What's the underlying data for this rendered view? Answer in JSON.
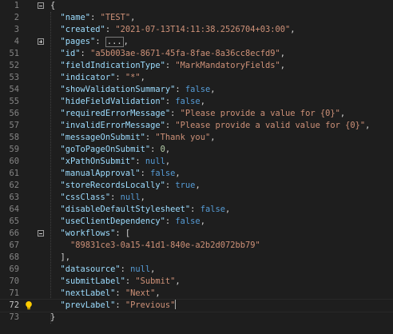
{
  "editor": {
    "lines": [
      {
        "ln": "1",
        "fold": "minus",
        "tokens": [
          {
            "t": "{",
            "c": "p"
          }
        ]
      },
      {
        "ln": "2",
        "tokens": [
          {
            "t": "  ",
            "c": "p"
          },
          {
            "t": "\"name\"",
            "c": "k"
          },
          {
            "t": ": ",
            "c": "p"
          },
          {
            "t": "\"TEST\"",
            "c": "s"
          },
          {
            "t": ",",
            "c": "p"
          }
        ]
      },
      {
        "ln": "3",
        "tokens": [
          {
            "t": "  ",
            "c": "p"
          },
          {
            "t": "\"created\"",
            "c": "k"
          },
          {
            "t": ": ",
            "c": "p"
          },
          {
            "t": "\"2021-07-13T14:11:38.2526704+03:00\"",
            "c": "s"
          },
          {
            "t": ",",
            "c": "p"
          }
        ]
      },
      {
        "ln": "4",
        "fold": "plus",
        "tokens": [
          {
            "t": "  ",
            "c": "p"
          },
          {
            "t": "\"pages\"",
            "c": "k"
          },
          {
            "t": ": ",
            "c": "p"
          },
          {
            "t": "...",
            "c": "collapsed"
          },
          {
            "t": ",",
            "c": "p"
          }
        ]
      },
      {
        "ln": "51",
        "tokens": [
          {
            "t": "  ",
            "c": "p"
          },
          {
            "t": "\"id\"",
            "c": "k"
          },
          {
            "t": ": ",
            "c": "p"
          },
          {
            "t": "\"a5b003ae-8671-45fa-8fae-8a36cc8ecfd9\"",
            "c": "s"
          },
          {
            "t": ",",
            "c": "p"
          }
        ]
      },
      {
        "ln": "52",
        "tokens": [
          {
            "t": "  ",
            "c": "p"
          },
          {
            "t": "\"fieldIndicationType\"",
            "c": "k"
          },
          {
            "t": ": ",
            "c": "p"
          },
          {
            "t": "\"MarkMandatoryFields\"",
            "c": "s"
          },
          {
            "t": ",",
            "c": "p"
          }
        ]
      },
      {
        "ln": "53",
        "tokens": [
          {
            "t": "  ",
            "c": "p"
          },
          {
            "t": "\"indicator\"",
            "c": "k"
          },
          {
            "t": ": ",
            "c": "p"
          },
          {
            "t": "\"*\"",
            "c": "s"
          },
          {
            "t": ",",
            "c": "p"
          }
        ]
      },
      {
        "ln": "54",
        "tokens": [
          {
            "t": "  ",
            "c": "p"
          },
          {
            "t": "\"showValidationSummary\"",
            "c": "k"
          },
          {
            "t": ": ",
            "c": "p"
          },
          {
            "t": "false",
            "c": "kw"
          },
          {
            "t": ",",
            "c": "p"
          }
        ]
      },
      {
        "ln": "55",
        "tokens": [
          {
            "t": "  ",
            "c": "p"
          },
          {
            "t": "\"hideFieldValidation\"",
            "c": "k"
          },
          {
            "t": ": ",
            "c": "p"
          },
          {
            "t": "false",
            "c": "kw"
          },
          {
            "t": ",",
            "c": "p"
          }
        ]
      },
      {
        "ln": "56",
        "tokens": [
          {
            "t": "  ",
            "c": "p"
          },
          {
            "t": "\"requiredErrorMessage\"",
            "c": "k"
          },
          {
            "t": ": ",
            "c": "p"
          },
          {
            "t": "\"Please provide a value for {0}\"",
            "c": "s"
          },
          {
            "t": ",",
            "c": "p"
          }
        ]
      },
      {
        "ln": "57",
        "tokens": [
          {
            "t": "  ",
            "c": "p"
          },
          {
            "t": "\"invalidErrorMessage\"",
            "c": "k"
          },
          {
            "t": ": ",
            "c": "p"
          },
          {
            "t": "\"Please provide a valid value for {0}\"",
            "c": "s"
          },
          {
            "t": ",",
            "c": "p"
          }
        ]
      },
      {
        "ln": "58",
        "tokens": [
          {
            "t": "  ",
            "c": "p"
          },
          {
            "t": "\"messageOnSubmit\"",
            "c": "k"
          },
          {
            "t": ": ",
            "c": "p"
          },
          {
            "t": "\"Thank you\"",
            "c": "s"
          },
          {
            "t": ",",
            "c": "p"
          }
        ]
      },
      {
        "ln": "59",
        "tokens": [
          {
            "t": "  ",
            "c": "p"
          },
          {
            "t": "\"goToPageOnSubmit\"",
            "c": "k"
          },
          {
            "t": ": ",
            "c": "p"
          },
          {
            "t": "0",
            "c": "n"
          },
          {
            "t": ",",
            "c": "p"
          }
        ]
      },
      {
        "ln": "60",
        "tokens": [
          {
            "t": "  ",
            "c": "p"
          },
          {
            "t": "\"xPathOnSubmit\"",
            "c": "k"
          },
          {
            "t": ": ",
            "c": "p"
          },
          {
            "t": "null",
            "c": "kw"
          },
          {
            "t": ",",
            "c": "p"
          }
        ]
      },
      {
        "ln": "61",
        "tokens": [
          {
            "t": "  ",
            "c": "p"
          },
          {
            "t": "\"manualApproval\"",
            "c": "k"
          },
          {
            "t": ": ",
            "c": "p"
          },
          {
            "t": "false",
            "c": "kw"
          },
          {
            "t": ",",
            "c": "p"
          }
        ]
      },
      {
        "ln": "62",
        "tokens": [
          {
            "t": "  ",
            "c": "p"
          },
          {
            "t": "\"storeRecordsLocally\"",
            "c": "k"
          },
          {
            "t": ": ",
            "c": "p"
          },
          {
            "t": "true",
            "c": "kw"
          },
          {
            "t": ",",
            "c": "p"
          }
        ]
      },
      {
        "ln": "63",
        "tokens": [
          {
            "t": "  ",
            "c": "p"
          },
          {
            "t": "\"cssClass\"",
            "c": "k"
          },
          {
            "t": ": ",
            "c": "p"
          },
          {
            "t": "null",
            "c": "kw"
          },
          {
            "t": ",",
            "c": "p"
          }
        ]
      },
      {
        "ln": "64",
        "tokens": [
          {
            "t": "  ",
            "c": "p"
          },
          {
            "t": "\"disableDefaultStylesheet\"",
            "c": "k"
          },
          {
            "t": ": ",
            "c": "p"
          },
          {
            "t": "false",
            "c": "kw"
          },
          {
            "t": ",",
            "c": "p"
          }
        ]
      },
      {
        "ln": "65",
        "tokens": [
          {
            "t": "  ",
            "c": "p"
          },
          {
            "t": "\"useClientDependency\"",
            "c": "k"
          },
          {
            "t": ": ",
            "c": "p"
          },
          {
            "t": "false",
            "c": "kw"
          },
          {
            "t": ",",
            "c": "p"
          }
        ]
      },
      {
        "ln": "66",
        "fold": "minus",
        "tokens": [
          {
            "t": "  ",
            "c": "p"
          },
          {
            "t": "\"workflows\"",
            "c": "k"
          },
          {
            "t": ": [",
            "c": "p"
          }
        ]
      },
      {
        "ln": "67",
        "tokens": [
          {
            "t": "    ",
            "c": "p"
          },
          {
            "t": "\"89831ce3-0a15-41d1-840e-a2b2d072bb79\"",
            "c": "s"
          }
        ]
      },
      {
        "ln": "68",
        "tokens": [
          {
            "t": "  ",
            "c": "p"
          },
          {
            "t": "],",
            "c": "p"
          }
        ]
      },
      {
        "ln": "69",
        "tokens": [
          {
            "t": "  ",
            "c": "p"
          },
          {
            "t": "\"datasource\"",
            "c": "k"
          },
          {
            "t": ": ",
            "c": "p"
          },
          {
            "t": "null",
            "c": "kw"
          },
          {
            "t": ",",
            "c": "p"
          }
        ]
      },
      {
        "ln": "70",
        "tokens": [
          {
            "t": "  ",
            "c": "p"
          },
          {
            "t": "\"submitLabel\"",
            "c": "k"
          },
          {
            "t": ": ",
            "c": "p"
          },
          {
            "t": "\"Submit\"",
            "c": "s"
          },
          {
            "t": ",",
            "c": "p"
          }
        ]
      },
      {
        "ln": "71",
        "tokens": [
          {
            "t": "  ",
            "c": "p"
          },
          {
            "t": "\"nextLabel\"",
            "c": "k"
          },
          {
            "t": ": ",
            "c": "p"
          },
          {
            "t": "\"Next\"",
            "c": "s"
          },
          {
            "t": ",",
            "c": "p"
          }
        ]
      },
      {
        "ln": "72",
        "active": true,
        "bulb": true,
        "cursor": true,
        "tokens": [
          {
            "t": "  ",
            "c": "p"
          },
          {
            "t": "\"prevLabel\"",
            "c": "k"
          },
          {
            "t": ": ",
            "c": "p"
          },
          {
            "t": "\"Previous\"",
            "c": "s"
          }
        ]
      },
      {
        "ln": "73",
        "tokens": [
          {
            "t": "}",
            "c": "p"
          }
        ]
      }
    ]
  },
  "colors": {
    "background": "#1e1e1e",
    "property": "#9cdcfe",
    "string": "#ce9178",
    "number": "#b5cea8",
    "keyword": "#569cd6",
    "line_number": "#858585",
    "lightbulb": "#ffcc00"
  },
  "icons": {
    "fold_expanded": "minus-box-icon",
    "fold_collapsed": "plus-box-icon",
    "quick_action": "lightbulb-icon"
  }
}
